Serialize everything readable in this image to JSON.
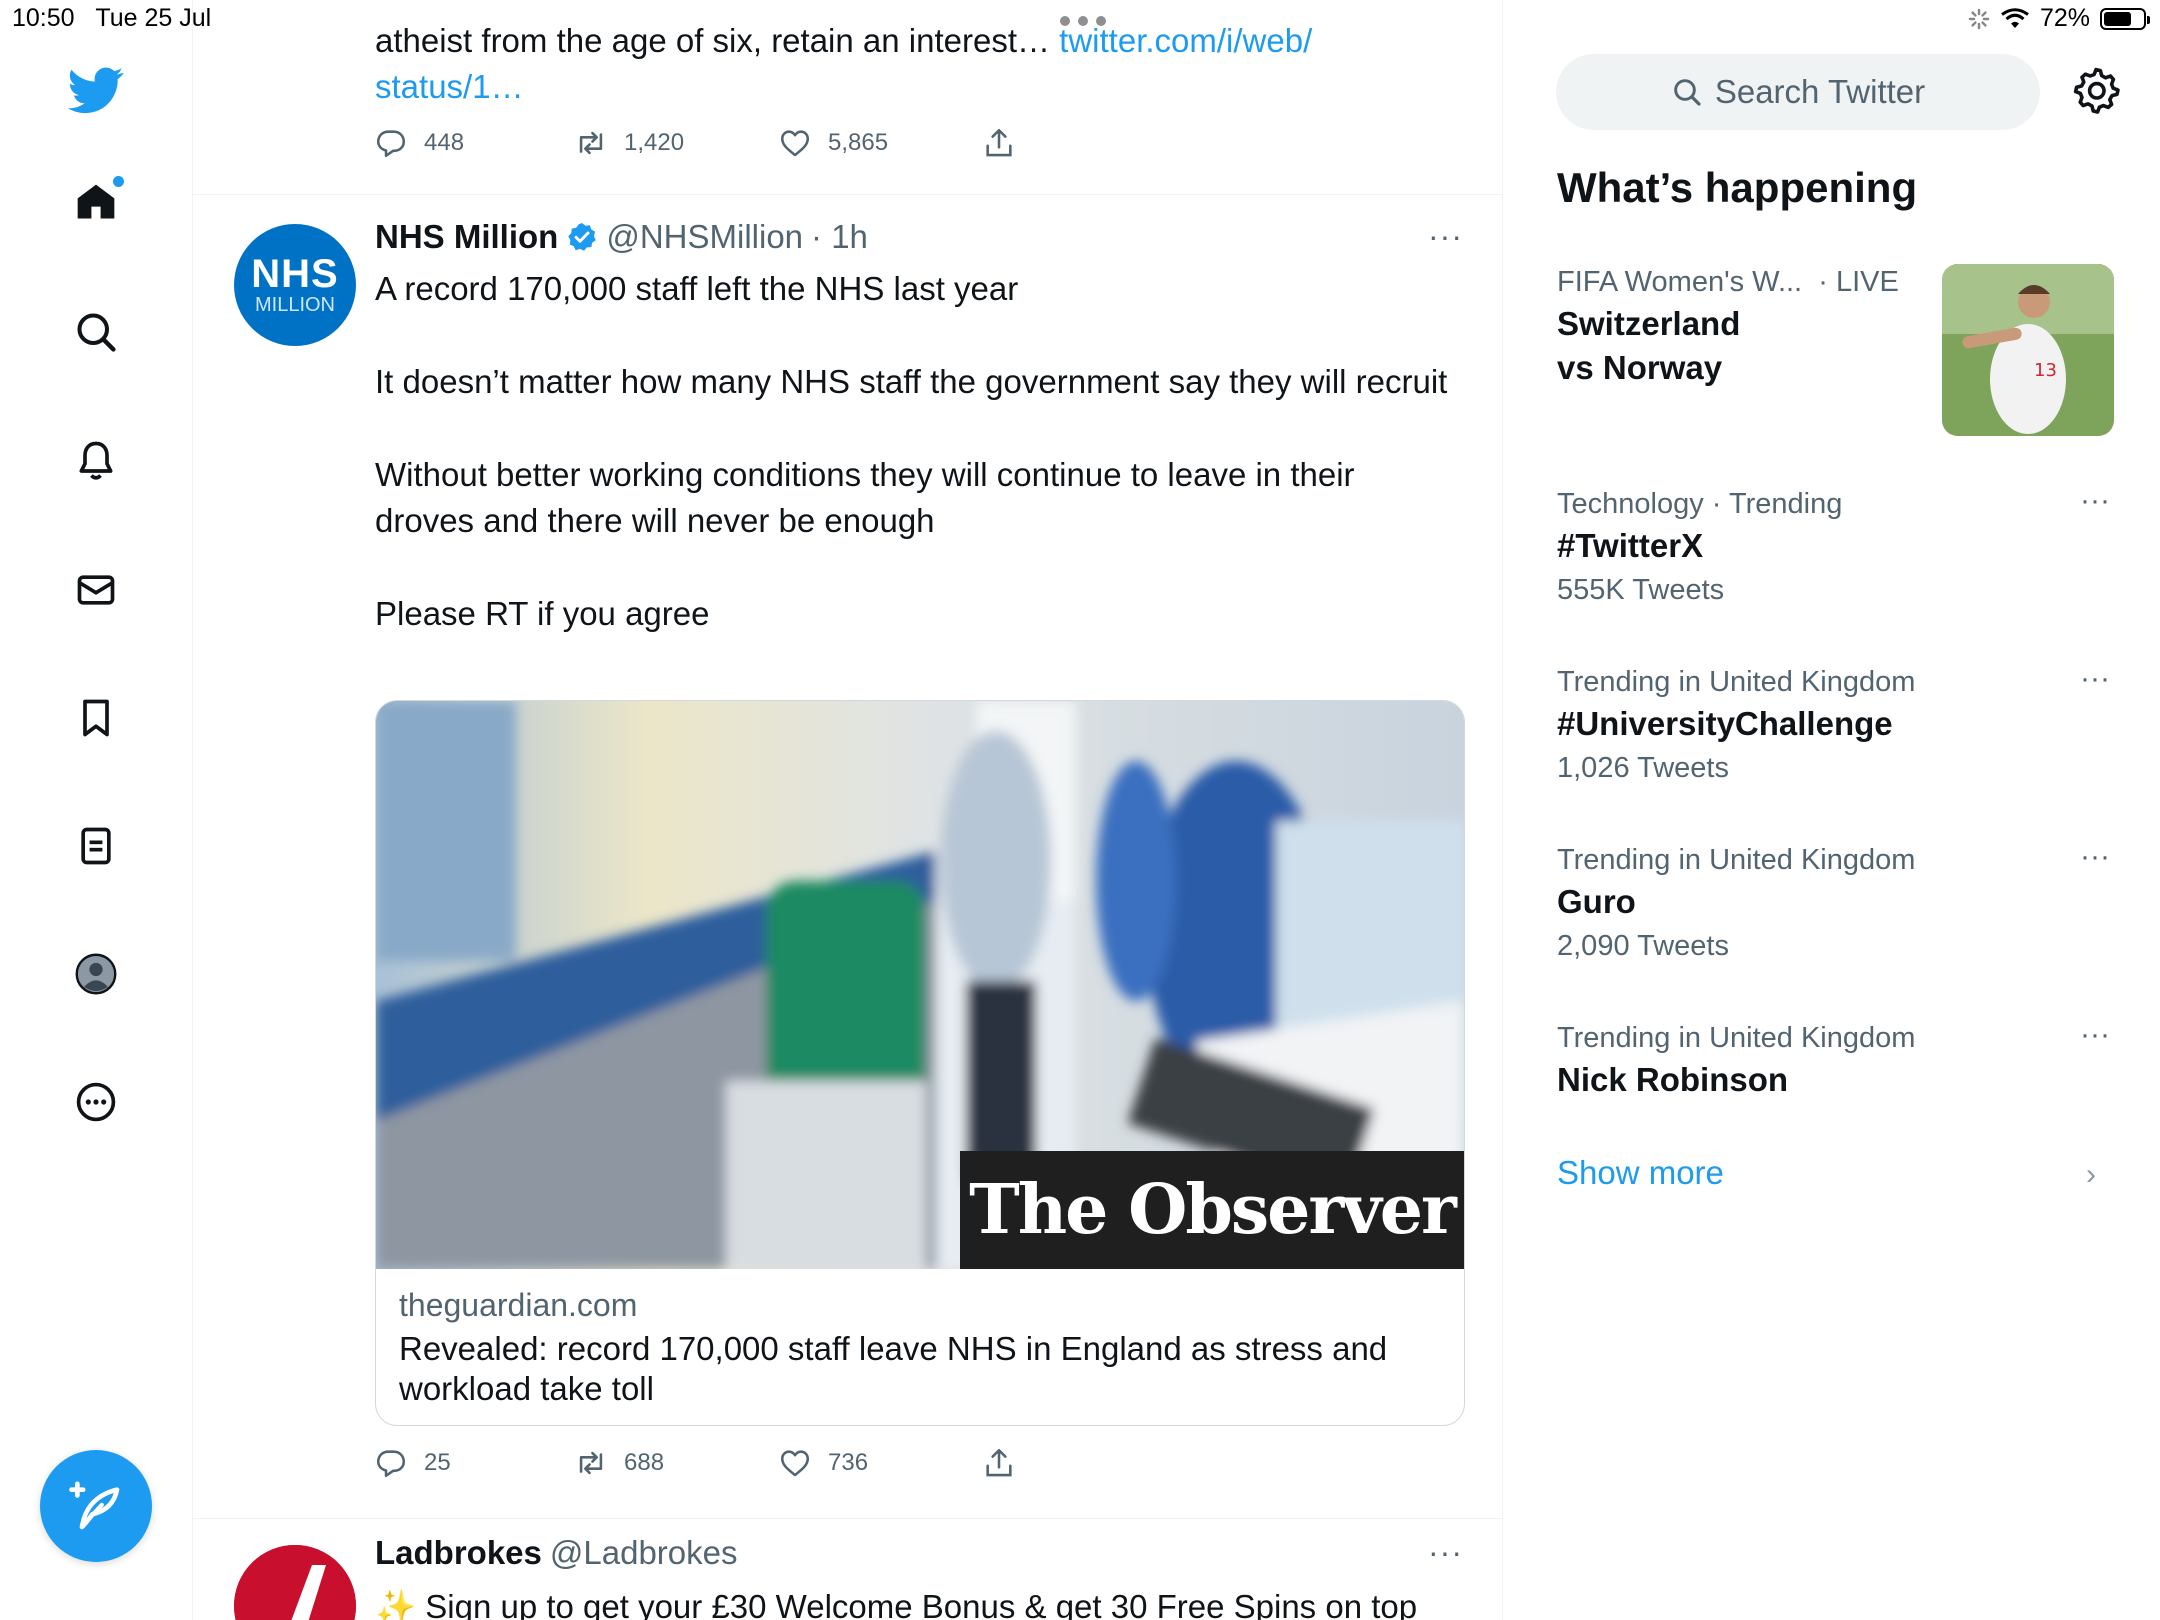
{
  "status_bar": {
    "time": "10:50",
    "date": "Tue 25 Jul",
    "battery": "72%",
    "battery_level": 0.72
  },
  "nav": {
    "items": [
      "home",
      "explore",
      "notifications",
      "messages",
      "bookmarks",
      "lists",
      "profile",
      "more"
    ],
    "compose_label": "Tweet"
  },
  "prev_tweet": {
    "text_tail": "atheist from the age of six, retain an interest…",
    "link_part1": " twitter.com/i/web/",
    "link_part2": "status/1…",
    "replies": "448",
    "retweets": "1,420",
    "likes": "5,865"
  },
  "tweet": {
    "author_name": "NHS Million",
    "handle": "@NHSMillion",
    "time": "· 1h",
    "avatar_text_big": "NHS",
    "avatar_text_small": "MILLION",
    "paragraphs": [
      "A record 170,000 staff left the NHS last year",
      "It doesn’t matter how many NHS staff the government say they will recruit",
      "Without better working conditions they will continue to leave in their droves and there will never be enough",
      "Please RT if you agree"
    ],
    "card": {
      "image_overlay": "The Observer",
      "domain": "theguardian.com",
      "title": "Revealed: record 170,000 staff leave NHS in England as stress and workload take toll"
    },
    "replies": "25",
    "retweets": "688",
    "likes": "736"
  },
  "next_tweet": {
    "author_name": "Ladbrokes",
    "handle": "@Ladbrokes",
    "text": "✨ Sign up to get your £30 Welcome Bonus & get 30 Free Spins on top"
  },
  "sidebar": {
    "search_placeholder": "Search Twitter",
    "heading": "What’s happening",
    "trends": [
      {
        "context": "FIFA Women's W...",
        "live": "· LIVE",
        "name_line1": "Switzerland",
        "name_line2": "vs Norway"
      },
      {
        "context": "Technology · Trending",
        "name": "#TwitterX",
        "count": "555K Tweets"
      },
      {
        "context": "Trending in United Kingdom",
        "name": "#UniversityChallenge",
        "count": "1,026 Tweets"
      },
      {
        "context": "Trending in United Kingdom",
        "name": "Guro",
        "count": "2,090 Tweets"
      },
      {
        "context": "Trending in United Kingdom",
        "name": "Nick Robinson"
      }
    ],
    "show_more": "Show more"
  },
  "colors": {
    "accent": "#1d9bf0",
    "text": "#0f1419",
    "secondary": "#536471"
  }
}
